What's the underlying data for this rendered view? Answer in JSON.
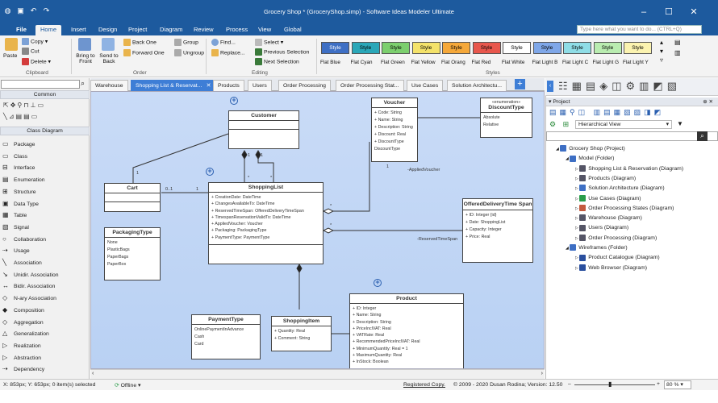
{
  "window": {
    "title": "Grocery Shop * (GroceryShop.simp) - Software Ideas Modeler Ultimate"
  },
  "menu": {
    "file": "File",
    "items": [
      "Home",
      "Insert",
      "Design",
      "Project",
      "Diagram",
      "Review",
      "Process",
      "View",
      "Global"
    ],
    "search_placeholder": "Type here what you want to do... (CTRL+Q)"
  },
  "ribbon": {
    "clipboard": {
      "paste": "Paste",
      "copy": "Copy",
      "cut": "Cut",
      "delete": "Delete",
      "label": "Clipboard"
    },
    "order": {
      "bring_front": "Bring to Front",
      "send_back": "Send to Back",
      "back_one": "Back One",
      "forward_one": "Forward One",
      "group": "Group",
      "ungroup": "Ungroup",
      "label": "Order"
    },
    "editing": {
      "find": "Find...",
      "replace": "Replace...",
      "select": "Select",
      "previous_selection": "Previous Selection",
      "next_selection": "Next Selection",
      "label": "Editing"
    },
    "styles": {
      "label": "Styles",
      "items": [
        {
          "name": "Flat Blue",
          "bg": "#3e6fc4",
          "fg": "#ffffff"
        },
        {
          "name": "Flat Cyan",
          "bg": "#2aa7b8",
          "fg": "#000000"
        },
        {
          "name": "Flat Green",
          "bg": "#7ccf6e",
          "fg": "#000000"
        },
        {
          "name": "Flat Yellow",
          "bg": "#f4e26a",
          "fg": "#000000"
        },
        {
          "name": "Flat Orang",
          "bg": "#f5a83a",
          "fg": "#000000"
        },
        {
          "name": "Flat Red",
          "bg": "#e8574d",
          "fg": "#000000"
        },
        {
          "name": "Flat White",
          "bg": "#ffffff",
          "fg": "#000000"
        },
        {
          "name": "Flat Light B",
          "bg": "#7fa7e8",
          "fg": "#000000"
        },
        {
          "name": "Flat Light C",
          "bg": "#8fdde6",
          "fg": "#000000"
        },
        {
          "name": "Flat Light G",
          "bg": "#b9ecb0",
          "fg": "#000000"
        },
        {
          "name": "Flat Light Y",
          "bg": "#fbf3b0",
          "fg": "#000000"
        }
      ],
      "style_word": "Style"
    }
  },
  "toolbox": {
    "search_value": "",
    "common_header": "Common",
    "class_header": "Class Diagram",
    "items": [
      "Package",
      "Class",
      "Interface",
      "Enumeration",
      "Structure",
      "Data Type",
      "Table",
      "Signal",
      "Collaboration",
      "Usage",
      "Association",
      "Unidir. Association",
      "Bidir. Association",
      "N-ary Association",
      "Composition",
      "Aggregation",
      "Generalization",
      "Realization",
      "Abstraction",
      "Dependency"
    ]
  },
  "tabs": [
    "Warehouse",
    "Shopping List & Reservat...",
    "Products",
    "Users",
    "Order Processing",
    "Order Processing Stat...",
    "Use Cases",
    "Solution Architectu..."
  ],
  "diagram": {
    "customer": {
      "name": "Customer"
    },
    "cart": {
      "name": "Cart"
    },
    "voucher": {
      "name": "Voucher",
      "attrs": [
        "+ Code: String",
        "+ Name: String",
        "+ Description: String",
        "+ Discount: Real",
        "+ DiscountType",
        "DiscountType"
      ]
    },
    "discounttype": {
      "stereo": "«enumeration»",
      "name": "DiscountType",
      "attrs": [
        "Absolute",
        "Relative"
      ]
    },
    "shoppinglist": {
      "name": "ShoppingList",
      "attrs": [
        "+ CreationDate: DateTime",
        "+ ChangesAvailableTo: DateTime",
        "+ ReservedTimeSpan: OfferedDeliveryTimeSpan",
        "+ TimespanReservationValidTo: DateTime",
        "+ AppliedVoucher: Voucher",
        "+ Packaging: PackagingType",
        "+ PaymentType: PaymentType"
      ]
    },
    "packagingtype": {
      "name": "PackagingType",
      "attrs": [
        "None",
        "PlasticBags",
        "PaperBags",
        "PaperBox"
      ]
    },
    "offered": {
      "name": "OfferedDeliveryTime Span",
      "attrs": [
        "+ ID: Integer {id}",
        "+ Date: ShoppingList",
        "+ Capacity: Integer",
        "+ Price: Real"
      ]
    },
    "paymenttype": {
      "name": "PaymentType",
      "attrs": [
        "OnlinePaymentInAdvance",
        "Cash",
        "Card"
      ]
    },
    "shoppingitem": {
      "name": "ShoppingItem",
      "attrs": [
        "+ Quantity: Real",
        "+ Comment: String"
      ]
    },
    "product": {
      "name": "Product",
      "attrs": [
        "+ ID: Integer",
        "+ Name: String",
        "+ Description: String",
        "+ PriceInclVAT: Real",
        "+ VATRate: Real",
        "+ RecommendedPriceInclVAT: Real",
        "+ MinimumQuantity: Real = 1",
        "+ MaximumQuantity: Real",
        "+ InStock: Boolean"
      ]
    },
    "labels": {
      "one_a": "1",
      "one_b": "1",
      "one_c": "1",
      "star_a": "*",
      "star_b": "*",
      "zero_one": "0..1",
      "one_d": "1",
      "applied": "-AppliedVoucher",
      "star_c": "*",
      "reserved": "-ReservedTimeSpan",
      "star_d": "*",
      "one_e": "1"
    }
  },
  "project": {
    "title": "Project",
    "view": "Hierarchical View",
    "tree": [
      {
        "label": "Grocery Shop (Project)",
        "level": 0,
        "color": "#3e6fc4"
      },
      {
        "label": "Model (Folder)",
        "level": 1,
        "color": "#3e6fc4"
      },
      {
        "label": "Shopping List & Reservation (Diagram)",
        "level": 2,
        "color": "#556"
      },
      {
        "label": "Products (Diagram)",
        "level": 2,
        "color": "#556"
      },
      {
        "label": "Solution Architecture (Diagram)",
        "level": 2,
        "color": "#3e6fc4"
      },
      {
        "label": "Use Cases (Diagram)",
        "level": 2,
        "color": "#2a9d4a"
      },
      {
        "label": "Order Processing States (Diagram)",
        "level": 2,
        "color": "#c45a3e"
      },
      {
        "label": "Warehouse (Diagram)",
        "level": 2,
        "color": "#556"
      },
      {
        "label": "Users (Diagram)",
        "level": 2,
        "color": "#556"
      },
      {
        "label": "Order Processing (Diagram)",
        "level": 2,
        "color": "#556"
      },
      {
        "label": "Wireframes (Folder)",
        "level": 1,
        "color": "#3e6fc4"
      },
      {
        "label": "Product Catalogue (Diagram)",
        "level": 2,
        "color": "#2a4f9e"
      },
      {
        "label": "Web Browser (Diagram)",
        "level": 2,
        "color": "#2a4f9e"
      }
    ]
  },
  "status": {
    "coords": "X: 853px; Y: 653px; 0 item(s) selected",
    "offline": "Offline",
    "registered": "Registered Copy.",
    "copyright": "© 2009 - 2020 Dusan Rodina; Version: 12.50",
    "zoom": "80 %"
  }
}
